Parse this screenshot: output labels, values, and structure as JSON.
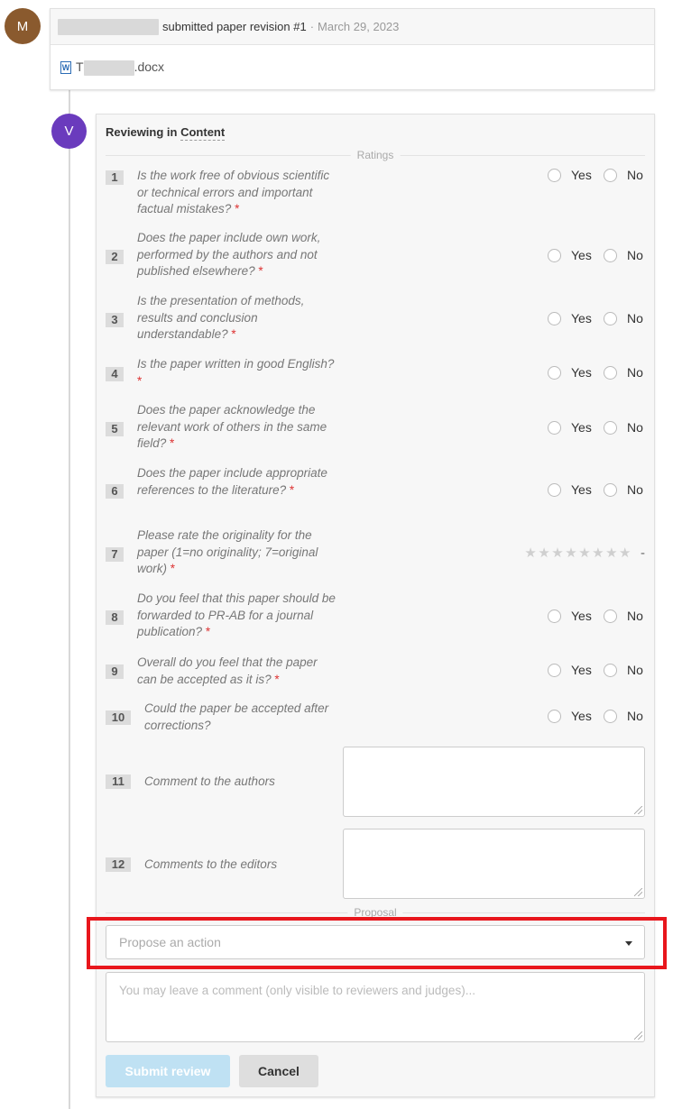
{
  "submission": {
    "avatar_letter": "M",
    "avatar_color": "#8a5a2e",
    "action_text": "submitted paper revision #1",
    "separator": "·",
    "date": "March 29, 2023",
    "file_prefix": "T",
    "file_ext": ".docx",
    "file_icon": "word-doc-icon"
  },
  "review": {
    "avatar_letter": "V",
    "avatar_color": "#6a3bbd",
    "title_prefix": "Reviewing in",
    "title_link": "Content",
    "ratings_label": "Ratings",
    "proposal_label": "Proposal",
    "yes_label": "Yes",
    "no_label": "No",
    "rating_value": "-",
    "questions": [
      {
        "num": "1",
        "text": "Is the work free of obvious scientific or technical errors and important factual mistakes?",
        "required": "*"
      },
      {
        "num": "2",
        "text": "Does the paper include own work, performed by the authors and not published elsewhere?",
        "required": "*"
      },
      {
        "num": "3",
        "text": "Is the presentation of methods, results and conclusion understandable?",
        "required": "*"
      },
      {
        "num": "4",
        "text": "Is the paper written in good English?",
        "required": "*"
      },
      {
        "num": "5",
        "text": "Does the paper acknowledge the relevant work of others in the same field?",
        "required": "*"
      },
      {
        "num": "6",
        "text": "Does the paper include appropriate references to the literature?",
        "required": "*"
      },
      {
        "num": "7",
        "text": "Please rate the originality for the paper (1=no originality; 7=original work)",
        "required": "*"
      },
      {
        "num": "8",
        "text": "Do you feel that this paper should be forwarded to PR-AB for a journal publication?",
        "required": "*"
      },
      {
        "num": "9",
        "text": "Overall do you feel that the paper can be accepted as it is?",
        "required": "*"
      },
      {
        "num": "10",
        "text": "Could the paper be accepted after corrections?",
        "required": ""
      },
      {
        "num": "11",
        "text": "Comment to the authors",
        "required": ""
      },
      {
        "num": "12",
        "text": "Comments to the editors",
        "required": ""
      }
    ],
    "propose_placeholder": "Propose an action",
    "comment_placeholder": "You may leave a comment (only visible to reviewers and judges)...",
    "submit_label": "Submit review",
    "cancel_label": "Cancel",
    "highlight_color": "#e8161c"
  }
}
